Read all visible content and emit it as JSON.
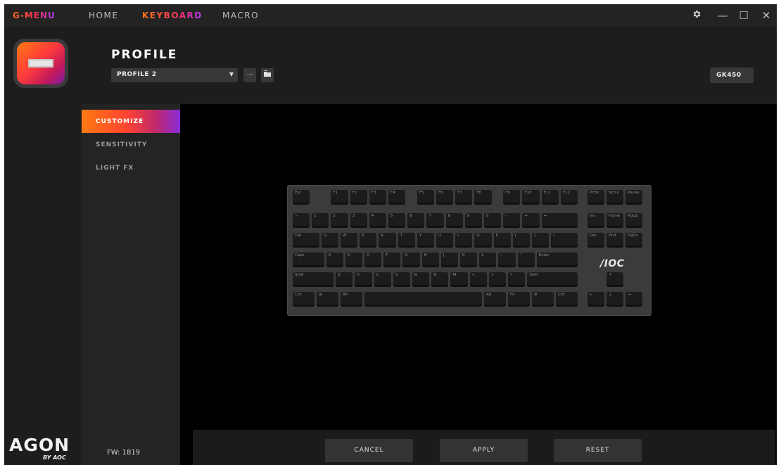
{
  "topbar": {
    "brand": "G-MENU",
    "nav": [
      "HOME",
      "KEYBOARD",
      "MACRO"
    ],
    "active_nav": "KEYBOARD",
    "settings_icon": "gear-icon",
    "minimize_icon": "minimize-icon",
    "maximize_icon": "maximize-icon",
    "close_icon": "close-icon"
  },
  "rail": {
    "logo_text": "AGON",
    "logo_sub": "BY AOC"
  },
  "header": {
    "title": "PROFILE",
    "profile_selected": "PROFILE 2",
    "more_label": "···",
    "model": "GK450"
  },
  "subnav": {
    "items": [
      "CUSTOMIZE",
      "SENSITIVITY",
      "LIGHT FX"
    ],
    "active": "CUSTOMIZE",
    "firmware": "FW: 1819"
  },
  "keyboard": {
    "brand": "/IOC",
    "rows": [
      [
        "Esc",
        "F1",
        "F2",
        "F3",
        "F4",
        "F5",
        "F6",
        "F7",
        "F8",
        "F9",
        "F10",
        "F11",
        "F12",
        "PrtSc",
        "ScrLk",
        "Pause"
      ],
      [
        "~",
        "1",
        "2",
        "3",
        "4",
        "5",
        "6",
        "7",
        "8",
        "9",
        "0",
        "-",
        "=",
        "←",
        "Ins",
        "Home",
        "PgUp"
      ],
      [
        "Tab",
        "Q",
        "W",
        "E",
        "R",
        "T",
        "Y",
        "U",
        "I",
        "O",
        "P",
        "[",
        "]",
        "\\",
        "Del",
        "End",
        "PgDn"
      ],
      [
        "Caps",
        "A",
        "S",
        "D",
        "F",
        "G",
        "H",
        "J",
        "K",
        "L",
        ";",
        "'",
        "Enter"
      ],
      [
        "Shift",
        "Z",
        "X",
        "C",
        "V",
        "B",
        "N",
        "M",
        "<",
        ">",
        "?",
        "Shift",
        "↑"
      ],
      [
        "Ctrl",
        "⊞",
        "Alt",
        "",
        "Alt",
        "Fn",
        "≣",
        "Ctrl",
        "←",
        "↓",
        "→"
      ]
    ]
  },
  "actions": {
    "cancel": "CANCEL",
    "apply": "APPLY",
    "reset": "RESET"
  },
  "colors": {
    "accent_start": "#ff7a12",
    "accent_mid": "#ff3060",
    "accent_end": "#a23bff",
    "background": "#151515"
  }
}
